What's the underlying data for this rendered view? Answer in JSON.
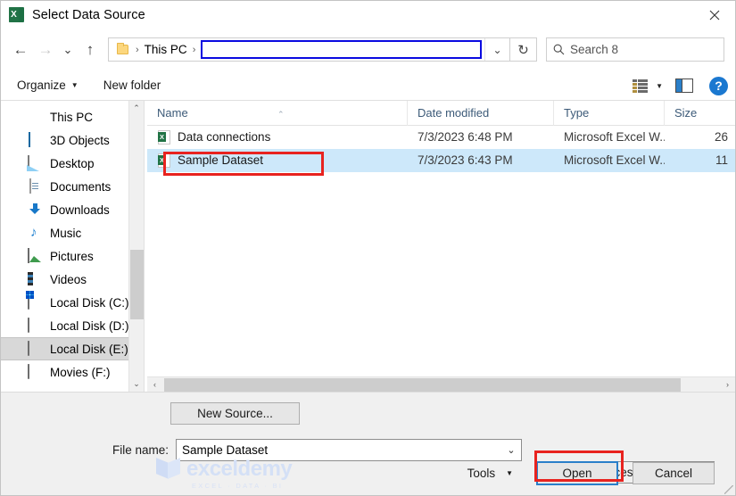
{
  "window": {
    "title": "Select Data Source",
    "app_icon": "excel-icon",
    "close_label": "×"
  },
  "nav": {
    "back": "←",
    "forward": "→",
    "recent": "⌄",
    "up": "↑",
    "refresh": "↻",
    "address_chevron": "⌄"
  },
  "breadcrumb": {
    "folder_icon": "folder-icon",
    "separator": "›",
    "items": [
      "This PC"
    ],
    "current_segment": ""
  },
  "search": {
    "icon": "search-icon",
    "placeholder": "Search 8"
  },
  "toolbar": {
    "organize": "Organize",
    "organize_caret": "▼",
    "new_folder": "New folder",
    "view_icon": "view-options-icon",
    "view_caret": "▼",
    "preview_pane_icon": "preview-pane-icon",
    "help_label": "?"
  },
  "sidebar": {
    "items": [
      {
        "label": "This PC",
        "icon": "this-pc-icon",
        "selected": false
      },
      {
        "label": "3D Objects",
        "icon": "3d-objects-icon",
        "selected": false
      },
      {
        "label": "Desktop",
        "icon": "desktop-icon",
        "selected": false
      },
      {
        "label": "Documents",
        "icon": "documents-icon",
        "selected": false
      },
      {
        "label": "Downloads",
        "icon": "downloads-icon",
        "selected": false
      },
      {
        "label": "Music",
        "icon": "music-icon",
        "selected": false
      },
      {
        "label": "Pictures",
        "icon": "pictures-icon",
        "selected": false
      },
      {
        "label": "Videos",
        "icon": "videos-icon",
        "selected": false
      },
      {
        "label": "Local Disk (C:)",
        "icon": "windows-disk-icon",
        "selected": false
      },
      {
        "label": "Local Disk (D:)",
        "icon": "disk-icon",
        "selected": false
      },
      {
        "label": "Local Disk (E:)",
        "icon": "disk-icon",
        "selected": true
      },
      {
        "label": "Movies (F:)",
        "icon": "disk-icon",
        "selected": false
      }
    ],
    "scroll_up": "⌃",
    "scroll_down": "⌄"
  },
  "filelist": {
    "columns": [
      {
        "label": "Name",
        "sorted": "asc",
        "sort_caret": "⌃"
      },
      {
        "label": "Date modified"
      },
      {
        "label": "Type"
      },
      {
        "label": "Size"
      }
    ],
    "rows": [
      {
        "name": "Data connections",
        "date_modified": "7/3/2023 6:48 PM",
        "type": "Microsoft Excel W...",
        "size": "26",
        "icon": "excel-file-icon",
        "selected": false
      },
      {
        "name": "Sample Dataset",
        "date_modified": "7/3/2023 6:43 PM",
        "type": "Microsoft Excel W...",
        "size": "11",
        "icon": "excel-file-icon",
        "selected": true
      }
    ],
    "hscroll_left": "‹",
    "hscroll_right": "›"
  },
  "footer": {
    "new_source": "New Source...",
    "file_name_label": "File name:",
    "file_name_value": "Sample Dataset",
    "file_name_chevron": "⌄",
    "filter_value": "All Data Sources",
    "filter_chevron": "⌄",
    "tools": "Tools",
    "tools_caret": "▼",
    "open": "Open",
    "cancel": "Cancel"
  },
  "watermark": {
    "brand": "exceldemy",
    "tagline": "EXCEL · DATA · BI"
  },
  "colors": {
    "accent_blue": "#2a7fc9",
    "selection_blue": "#cde8fa",
    "annotation_red": "#e8231f",
    "excel_green": "#217346"
  }
}
